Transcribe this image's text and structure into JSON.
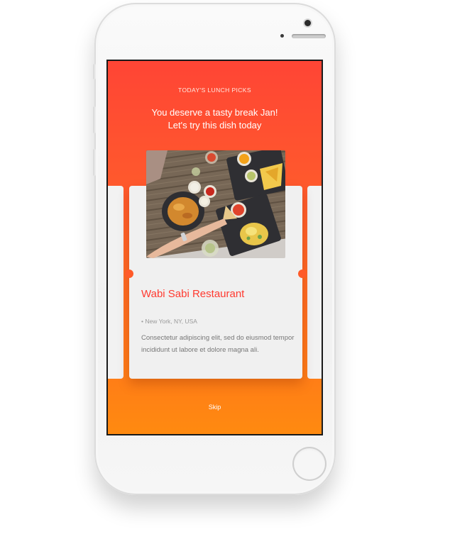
{
  "header": {
    "eyebrow": "TODAY'S LUNCH PICKS",
    "headline_line1": "You deserve a tasty break Jan!",
    "headline_line2": "Let's try this dish today"
  },
  "card": {
    "title": "Wabi Sabi Restaurant",
    "location": "New York, NY, USA",
    "description": "Consectetur  adipiscing elit, sed do eiusmod tempor incididunt ut labore et dolore magna ali."
  },
  "footer": {
    "skip_label": "Skip"
  },
  "colors": {
    "accent": "#ff3a30",
    "gradient_top": "#ff4535",
    "gradient_bottom": "#ff8a10"
  }
}
